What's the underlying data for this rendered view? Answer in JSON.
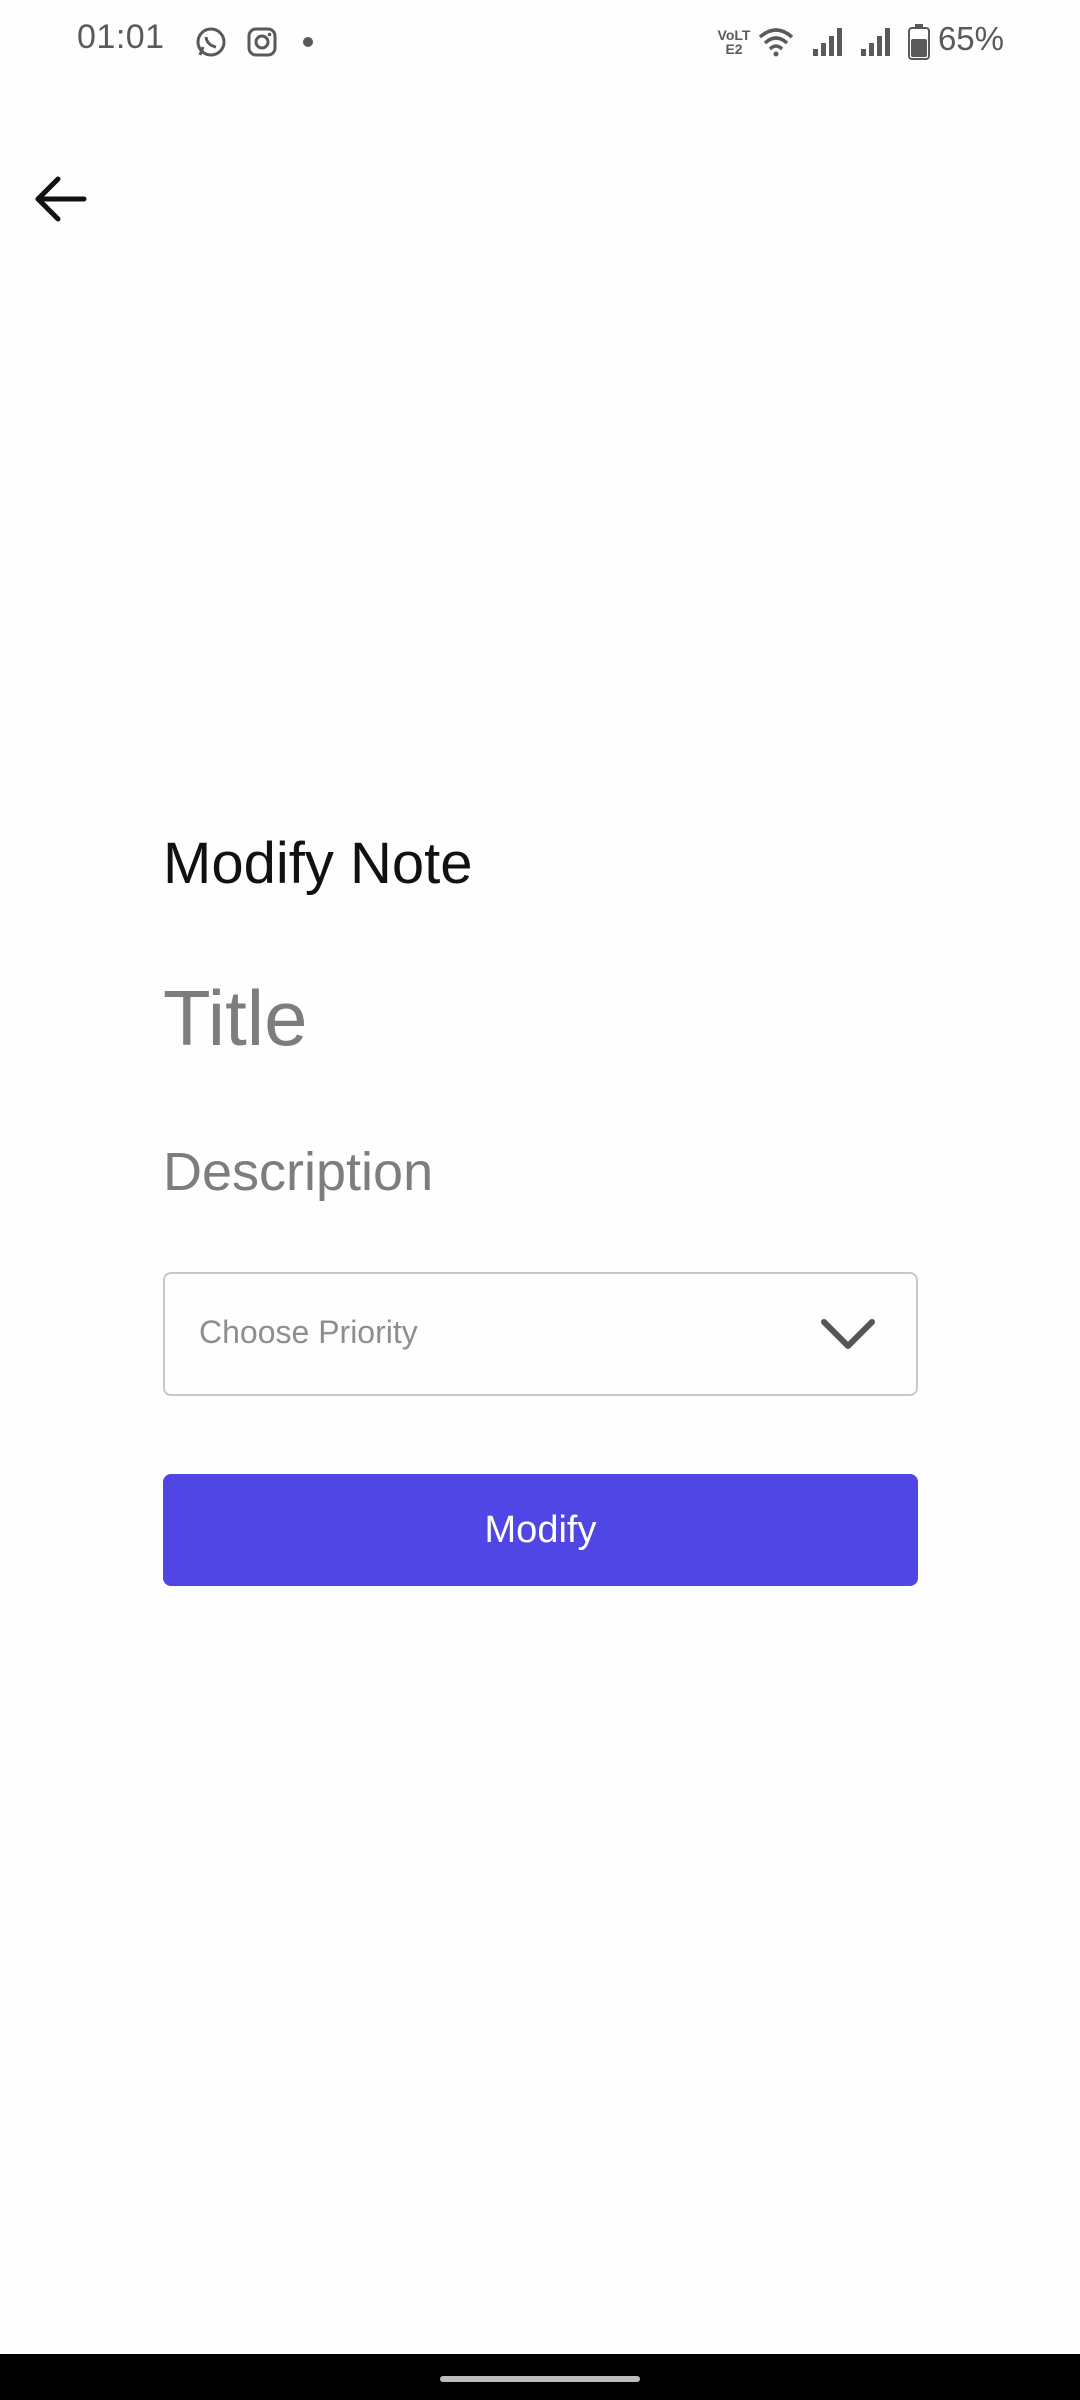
{
  "status_bar": {
    "time": "01:01",
    "battery_percent": "65%",
    "battery_level": 0.65,
    "network_label": "VoLTE2",
    "icons": [
      "whatsapp-icon",
      "instagram-icon",
      "notification-dot-icon",
      "volte-icon",
      "wifi-icon",
      "signal-1-icon",
      "signal-2-icon",
      "battery-icon"
    ]
  },
  "header": {
    "back_icon": "arrow-left-icon"
  },
  "form": {
    "page_title": "Modify Note",
    "title_placeholder": "Title",
    "title_value": "",
    "description_placeholder": "Description",
    "description_value": "",
    "priority": {
      "placeholder": "Choose Priority",
      "selected": "",
      "icon": "chevron-down-icon"
    },
    "submit_label": "Modify"
  },
  "colors": {
    "accent": "#4f46e5",
    "background": "#fefefe",
    "placeholder": "#7d7d7d"
  }
}
